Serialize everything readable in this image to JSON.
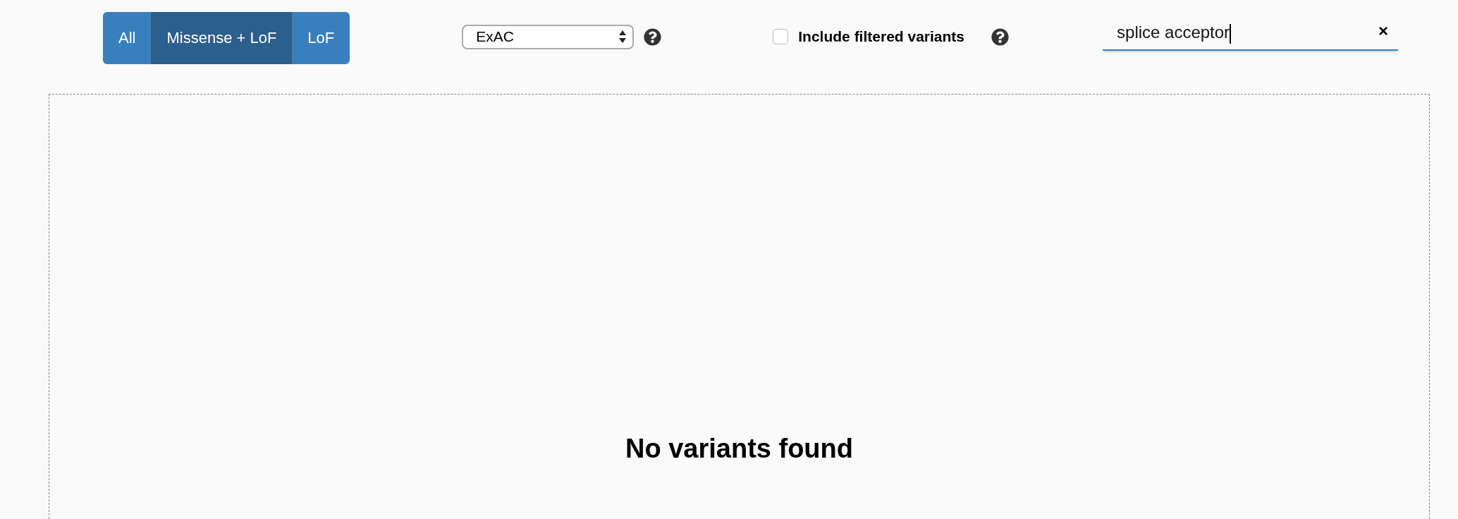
{
  "consequence_filter": [
    {
      "label": "All",
      "selected": false
    },
    {
      "label": "Missense + LoF",
      "selected": true
    },
    {
      "label": "LoF",
      "selected": false
    }
  ],
  "dataset_select": {
    "value": "ExAC"
  },
  "include_filtered": {
    "label": "Include filtered variants",
    "checked": false
  },
  "search": {
    "value": "splice acceptor",
    "clear": "×"
  },
  "table": {
    "empty_message": "No variants found"
  }
}
